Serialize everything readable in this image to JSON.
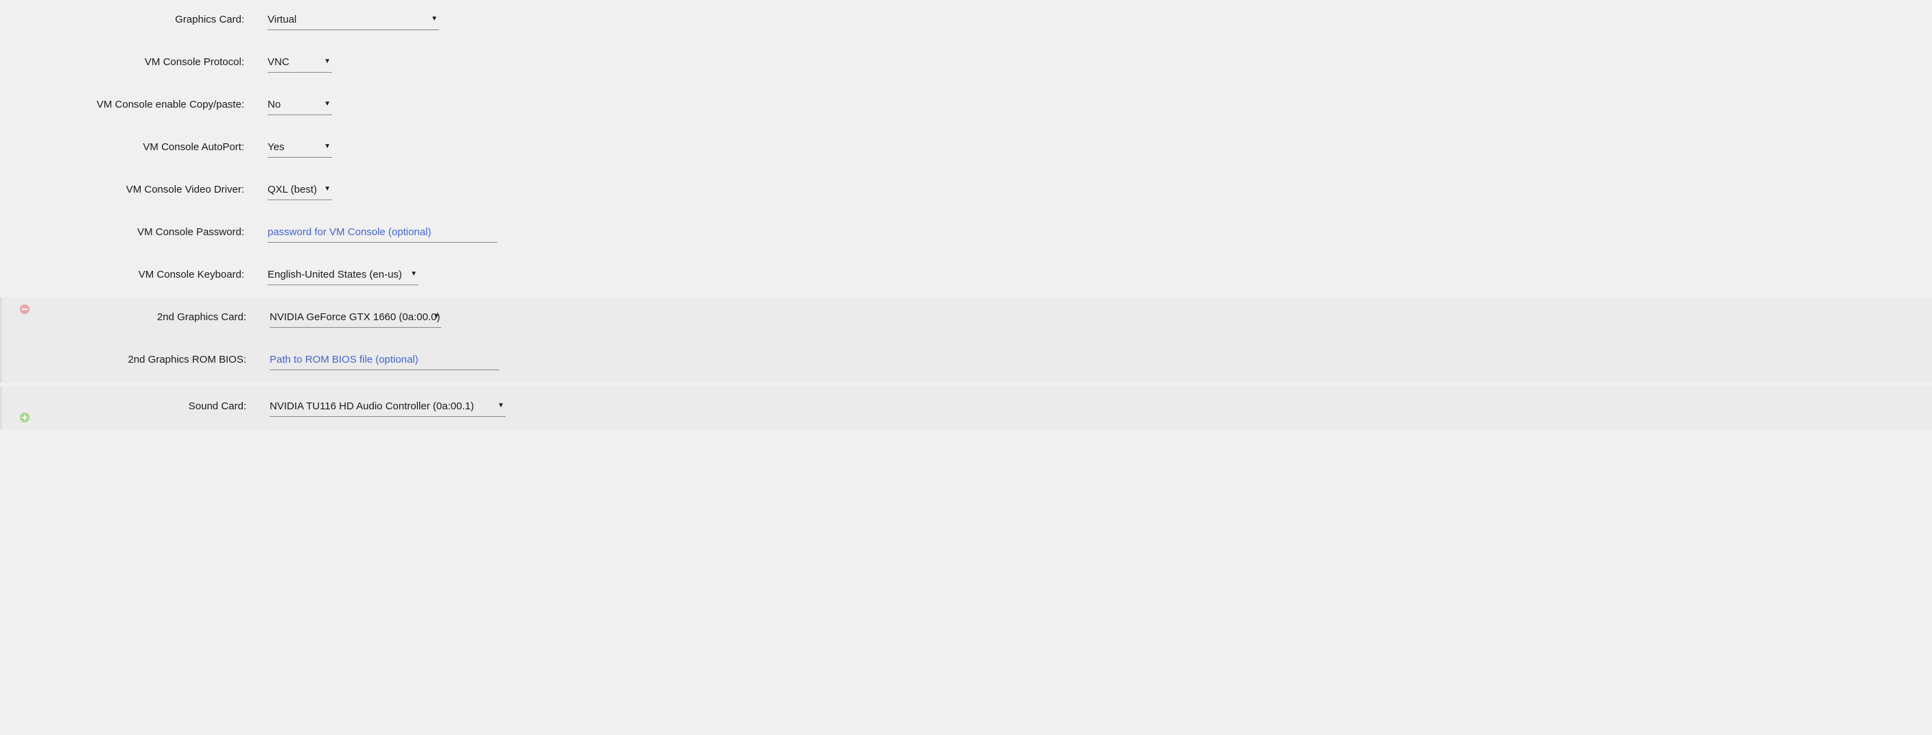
{
  "main": {
    "graphics_card": {
      "label": "Graphics Card:",
      "value": "Virtual"
    },
    "vm_console_protocol": {
      "label": "VM Console Protocol:",
      "value": "VNC"
    },
    "vm_console_copy_paste": {
      "label": "VM Console enable Copy/paste:",
      "value": "No"
    },
    "vm_console_autoport": {
      "label": "VM Console AutoPort:",
      "value": "Yes"
    },
    "vm_console_video_driver": {
      "label": "VM Console Video Driver:",
      "value": "QXL (best)"
    },
    "vm_console_password": {
      "label": "VM Console Password:",
      "placeholder": "password for VM Console (optional)",
      "value": ""
    },
    "vm_console_keyboard": {
      "label": "VM Console Keyboard:",
      "value": "English-United States (en-us)"
    }
  },
  "second": {
    "graphics_card": {
      "label": "2nd Graphics Card:",
      "value": "NVIDIA GeForce GTX 1660 (0a:00.0)"
    },
    "rom_bios": {
      "label": "2nd Graphics ROM BIOS:",
      "placeholder": "Path to ROM BIOS file (optional)",
      "value": ""
    }
  },
  "sound": {
    "sound_card": {
      "label": "Sound Card:",
      "value": "NVIDIA TU116 HD Audio Controller (0a:00.1)"
    }
  }
}
